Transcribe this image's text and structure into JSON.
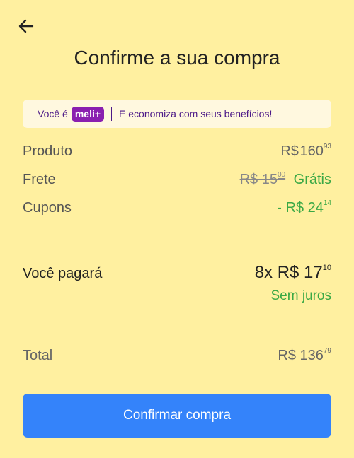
{
  "header": {
    "back_icon": "arrow-left-icon",
    "title": "Confirme a sua compra"
  },
  "banner": {
    "prefix": "Você é",
    "badge": "meli+",
    "message": "E economiza com seus benefícios!",
    "badge_color": "#8a1fb0",
    "text_color": "#4d1a88"
  },
  "summary": {
    "product": {
      "label": "Produto",
      "currency": "R$",
      "amount": "160",
      "cents": "93"
    },
    "shipping": {
      "label": "Frete",
      "old_price": "R$ 15",
      "old_cents": "00",
      "free_label": "Grátis"
    },
    "coupons": {
      "label": "Cupons",
      "amount": "- R$ 24",
      "cents": "14"
    }
  },
  "payment": {
    "label": "Você pagará",
    "installments": "8x R$ 17",
    "cents": "10",
    "interest": "Sem juros"
  },
  "total": {
    "label": "Total",
    "amount": "R$ 136",
    "cents": "79"
  },
  "cta": {
    "label": "Confirmar compra",
    "color": "#3483fa"
  },
  "colors": {
    "background": "#fff0a0",
    "green": "#3aa845"
  }
}
